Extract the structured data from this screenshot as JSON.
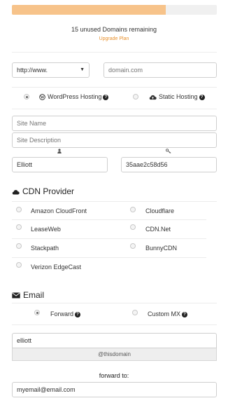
{
  "progress": {
    "fraction": 0.75,
    "fill_color": "#f7c38a"
  },
  "domains": {
    "remaining_text": "15 unused Domains remaining",
    "upgrade_link": "Upgrade Plan"
  },
  "domain_form": {
    "protocol_value": "http://www.",
    "domain_placeholder": "domain.com"
  },
  "hosting": {
    "wordpress_label": "WordPress Hosting",
    "static_label": "Static Hosting",
    "selected": "wordpress"
  },
  "site": {
    "name_placeholder": "Site Name",
    "description_placeholder": "Site Description",
    "username_value": "Elliott",
    "password_value": "35aae2c58d56",
    "user_icon": "user-icon",
    "key_icon": "key-icon"
  },
  "cdn": {
    "title": "CDN Provider",
    "icon": "cloud-icon",
    "options": [
      "Amazon CloudFront",
      "Cloudflare",
      "LeaseWeb",
      "CDN.Net",
      "Stackpath",
      "BunnyCDN",
      "Verizon EdgeCast"
    ]
  },
  "email": {
    "title": "Email",
    "icon": "envelope-icon",
    "forward_label": "Forward",
    "custom_mx_label": "Custom MX",
    "selected": "forward",
    "local_part_value": "elliott",
    "domain_suffix": "@thisdomain",
    "forward_to_label": "forward to:",
    "forward_address_value": "myemail@email.com"
  },
  "colors": {
    "accent": "#e8902b",
    "border": "#cfcfcf"
  }
}
